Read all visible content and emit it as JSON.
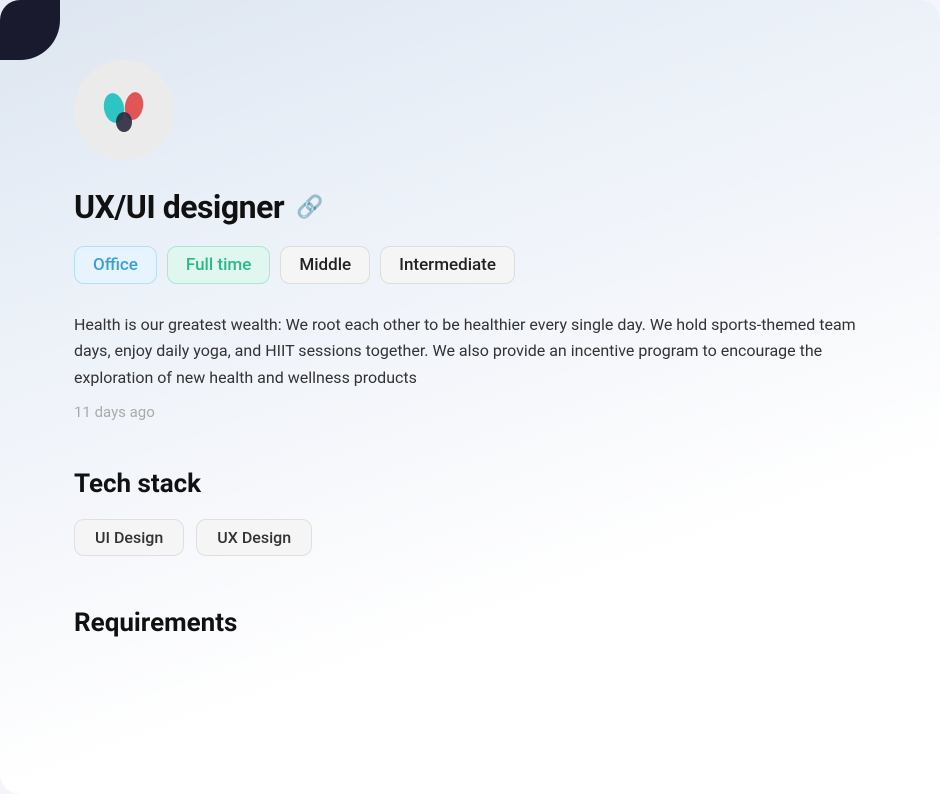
{
  "page": {
    "background": "linear-gradient(160deg, #dde5f0, #ffffff)",
    "corner_decoration": true
  },
  "logo": {
    "alt": "Company logo"
  },
  "job": {
    "title": "UX/UI designer",
    "link_icon": "🔗"
  },
  "tags": [
    {
      "id": "office",
      "label": "Office",
      "style": "office"
    },
    {
      "id": "fulltime",
      "label": "Full time",
      "style": "fulltime"
    },
    {
      "id": "middle",
      "label": "Middle",
      "style": "middle"
    },
    {
      "id": "intermediate",
      "label": "Intermediate",
      "style": "intermediate"
    }
  ],
  "description": "Health is our greatest wealth: We root each other to be healthier every single day. We hold sports-themed team days, enjoy daily yoga, and HIIT sessions together. We also provide an incentive program to encourage the exploration of new health and wellness products",
  "timestamp": "11 days ago",
  "tech_stack": {
    "title": "Tech stack",
    "items": [
      {
        "label": "UI Design"
      },
      {
        "label": "UX Design"
      }
    ]
  },
  "requirements": {
    "title": "Requirements"
  }
}
